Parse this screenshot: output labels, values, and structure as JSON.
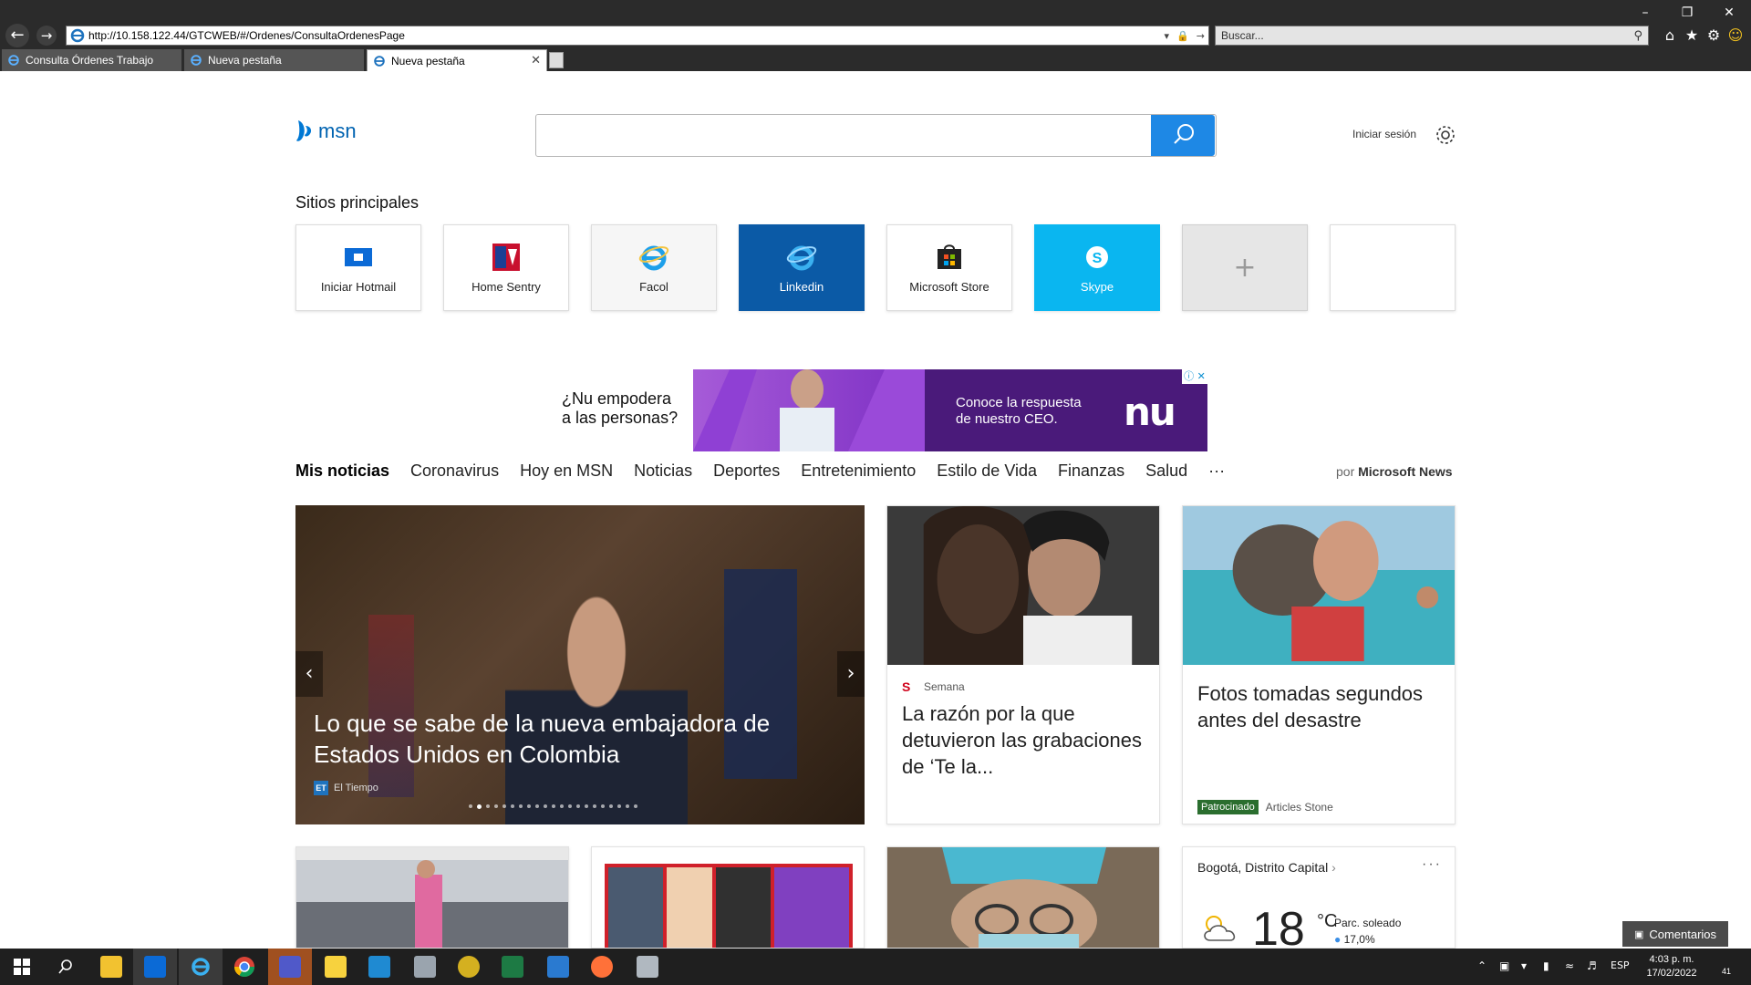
{
  "browser": {
    "url": "http://10.158.122.44/GTCWEB/#/Ordenes/ConsultaOrdenesPage",
    "search_placeholder": "Buscar...",
    "tabs": [
      {
        "label": "Consulta Órdenes Trabajo",
        "active": false
      },
      {
        "label": "Nueva pestaña",
        "active": false
      },
      {
        "label": "Nueva pestaña",
        "active": true
      }
    ]
  },
  "msn": {
    "logo_text": "msn",
    "signin_label": "Iniciar sesión",
    "top_sites_title": "Sitios principales",
    "top_sites": [
      {
        "label": "Iniciar Hotmail",
        "icon": "outlook-icon"
      },
      {
        "label": "Home Sentry",
        "icon": "home-sentry-icon"
      },
      {
        "label": "Facol",
        "icon": "ie-icon"
      },
      {
        "label": "Linkedin",
        "icon": "ie-icon"
      },
      {
        "label": "Microsoft Store",
        "icon": "store-icon"
      },
      {
        "label": "Skype",
        "icon": "skype-icon"
      }
    ],
    "ad": {
      "left_text_1": "¿Nu empodera",
      "left_text_2": "a las personas?",
      "right_text_1": "Conoce la respuesta",
      "right_text_2": "de nuestro CEO.",
      "brand": "nu"
    },
    "news_nav": [
      "Mis noticias",
      "Coronavirus",
      "Hoy en MSN",
      "Noticias",
      "Deportes",
      "Entretenimiento",
      "Estilo de Vida",
      "Finanzas",
      "Salud",
      "···"
    ],
    "powered_by_prefix": "por",
    "powered_by": "Microsoft News",
    "hero": {
      "headline": "Lo que se sabe de la nueva embajadora de Estados Unidos en Colombia",
      "source": "El Tiempo",
      "source_badge": "ET"
    },
    "card2": {
      "source": "Semana",
      "source_badge": "S",
      "title": "La razón por la que detuvieron las grabaciones de ‘Te la..."
    },
    "card3": {
      "title": "Fotos tomadas segundos antes del desastre",
      "sponsored_label": "Patrocinado",
      "sponsor": "Articles Stone"
    },
    "weather": {
      "location": "Bogotá, Distrito Capital",
      "more": "···",
      "temp": "18",
      "unit": "°C",
      "condition": "Parc. soleado",
      "humidity": "17,0%"
    },
    "feedback_label": "Comentarios"
  },
  "taskbar": {
    "language": "ESP",
    "time": "4:03 p. m.",
    "date": "17/02/2022",
    "notifications": "41"
  },
  "colors": {
    "accent": "#1e88e5",
    "linkedin_tile": "#0b5aa6",
    "skype_tile": "#0ab6f0",
    "sponsored": "#2b6e2f"
  }
}
